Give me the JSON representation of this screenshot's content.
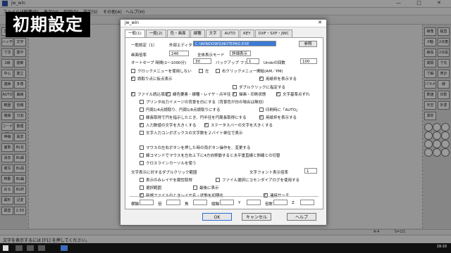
{
  "app": {
    "title": "jw_win",
    "window_controls": "— □ ✕",
    "menu": [
      "ファイル(F)",
      "編集(E)",
      "表示(V)",
      "作図(D)",
      "設定(S)",
      "その他(A)",
      "ヘルプ(H)"
    ],
    "left_tools": [
      "直線",
      "矩形",
      "ハッチ",
      "文字",
      "寸法",
      "建平",
      "2線",
      "建断",
      "中心",
      "建立",
      "連線",
      "多角",
      "AUTO",
      "曲線",
      "範囲",
      "包絡",
      "複線",
      "分割",
      "コーナー",
      "整理",
      "伸縮",
      "属変",
      "面取",
      "BL化",
      "消去",
      "BL解",
      "複写",
      "BL属",
      "移動",
      "BL編",
      "戻る",
      "BL終",
      "図形",
      "記変",
      "図登",
      "2.5D"
    ],
    "right_tools": [
      "線角",
      "鉛直",
      "X軸",
      "2点角",
      "線長",
      "2点長",
      "間隔",
      "寸化",
      "寸解",
      "表計",
      "パラメ",
      "線",
      "数値",
      "日影",
      "天空",
      "外変",
      "測定"
    ],
    "status_left": "A-4",
    "status_right": "S=1/1",
    "command_text": "文字を表示するには [F1] を押してください。",
    "clock": "19:10"
  },
  "overlay": {
    "title": "初期設定"
  },
  "dialog": {
    "title": "jw_win",
    "close": "✕",
    "tabs": [
      "一般(1)",
      "一般(2)",
      "色・画面",
      "線種",
      "文字",
      "AUTO",
      "KEY",
      "DXF・SXF・JWC"
    ],
    "active_tab": 0,
    "section_label": "一般設定（1）",
    "editor_label": "外部エディタ",
    "editor_value": "C:\\WINDOWS\\NOTEPAD.EXE",
    "browse_label": "参照",
    "rows": {
      "buffer_label": "画面倍率",
      "buffer_value": "246",
      "draw_mode_label": "全体表示モード",
      "draw_mode_value": "詳細表示",
      "undo_count_label": "Undoの回数",
      "undo_count_value": "100",
      "auto_save_label": "オートセーブ 時間(1〜1000分)",
      "auto_save_value": "30",
      "backup_label": "バックアップ ファイル数",
      "backup_value": "1",
      "print_width_label": "印刷幅",
      "print_width_value": "100"
    },
    "checks": [
      {
        "label": "クロックメニューを使用しない",
        "on": false
      },
      {
        "label": "左",
        "on": false
      },
      {
        "label": "右クリックメニュー開始(AM／PM)",
        "on": false
      },
      {
        "label": "読取り点に仮点表示",
        "on": true
      },
      {
        "label": "ダブルクリックに指定する",
        "on": false
      },
      {
        "label": "用紙枠を表示する",
        "on": true
      },
      {
        "label": "ファイル読込項目",
        "on": true
      },
      {
        "label": "線色要素・線種・レイヤ・点半径",
        "on": true
      },
      {
        "label": "描画・印刷状態",
        "on": true
      },
      {
        "label": "文字基準点ずれ",
        "on": true
      },
      {
        "label": "プリンタ出力イメージの背景を白にする（背景色が白の場合は無効）",
        "on": false
      },
      {
        "label": "円周1/4点読取り、円周1/8点読取りにする",
        "on": false
      },
      {
        "label": "印刷時に「AUTO」",
        "on": false
      },
      {
        "label": "線長取得で円を指示したとき、円半径を円周長取得にする",
        "on": false
      },
      {
        "label": "用紙枠を表示する",
        "on": true
      },
      {
        "label": "入力数値の文字を大きくする",
        "on": true
      },
      {
        "label": "ステータスバーの文字を大きくする",
        "on": true
      },
      {
        "label": "文字入力コンボボックスの文字数を２バイト単位で表示",
        "on": false
      },
      {
        "label": "マウスの左右ボタンを押した時の両ボタン操作を、変更する",
        "on": false
      },
      {
        "label": "線コマンドでマウスを左右上下に4方向移動すると水平垂直線と斜線との切替",
        "on": false
      },
      {
        "label": "クロスラインカーソルを使う",
        "on": false
      },
      {
        "label": "表示のみレイヤを属性取得",
        "on": false
      },
      {
        "label": "ファイル選択にコモンダイアログを使用する",
        "on": false
      },
      {
        "label": "選択範囲",
        "on": false
      },
      {
        "label": "最後に表示",
        "on": false
      },
      {
        "label": "新規ファイルのときレイヤ名・状態を初期化",
        "on": true
      },
      {
        "label": "連接サーチ",
        "on": true
      }
    ],
    "text_rows": {
      "display_limit_label": "文字表示に対するダブルクリック範囲",
      "font_label": "文字フォント表示倍率",
      "font_value": "1",
      "bottom_labels": [
        "横軸",
        "倍",
        "角",
        "縦軸",
        "Y",
        "倍数",
        "Z"
      ]
    },
    "buttons": {
      "ok": "OK",
      "cancel": "キャンセル",
      "help": "ヘルプ"
    }
  }
}
